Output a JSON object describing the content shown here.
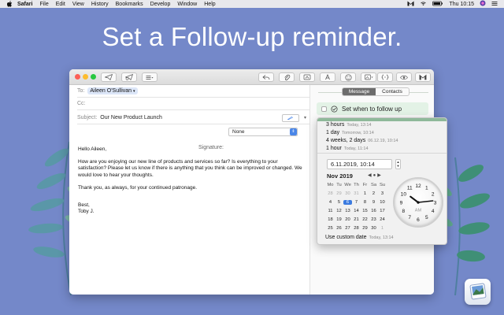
{
  "menubar": {
    "items": [
      "Safari",
      "File",
      "Edit",
      "View",
      "History",
      "Bookmarks",
      "Develop",
      "Window",
      "Help"
    ],
    "clock": "Thu 10:15"
  },
  "headline": "Set a Follow-up reminder.",
  "compose": {
    "to_label": "To:",
    "to_recipient": "Aileen O'Sullivan",
    "cc_label": "Cc:",
    "subject_label": "Subject:",
    "subject_value": "Our New Product Launch",
    "signature_label": "Signature:",
    "signature_value": "None",
    "body": {
      "greeting": "Hello Aileen,",
      "paragraph1": "How are you enjoying our new line of products and services so far? Is everything to your satisfaction? Please let us know if there is anything that you think can be improved or changed. We would love to hear your thoughts.",
      "paragraph2": "Thank you, as always, for your continued patronage.",
      "signoff": "Best,",
      "name": "Toby J."
    }
  },
  "sidepanel": {
    "tabs": [
      {
        "label": "Message"
      },
      {
        "label": "Contacts"
      }
    ],
    "followup_label": "Set when to follow up"
  },
  "popover": {
    "options": [
      {
        "label": "3 hours",
        "meta": "Today, 13:14"
      },
      {
        "label": "1 day",
        "meta": "Tomorrow, 10:14"
      },
      {
        "label": "4 weeks, 2 days",
        "meta": "06.12.19, 10:14"
      },
      {
        "label": "1 hour",
        "meta": "Today, 11:14"
      }
    ],
    "date_value": "6.11.2019, 10:14",
    "calendar": {
      "month": "Nov 2019",
      "weekdays": [
        "Mo",
        "Tu",
        "We",
        "Th",
        "Fr",
        "Sa",
        "Su"
      ],
      "days": [
        [
          "28",
          "29",
          "30",
          "31",
          "1",
          "2",
          "3"
        ],
        [
          "4",
          "5",
          "6",
          "7",
          "8",
          "9",
          "10"
        ],
        [
          "11",
          "12",
          "13",
          "14",
          "15",
          "16",
          "17"
        ],
        [
          "18",
          "19",
          "20",
          "21",
          "22",
          "23",
          "24"
        ],
        [
          "25",
          "26",
          "27",
          "28",
          "29",
          "30",
          "1"
        ]
      ],
      "selected": "6"
    },
    "clock": {
      "hour": 10,
      "minute": 14,
      "ampm": "AM"
    },
    "custom_label": "Use custom date",
    "custom_meta": "Today, 13:14"
  }
}
